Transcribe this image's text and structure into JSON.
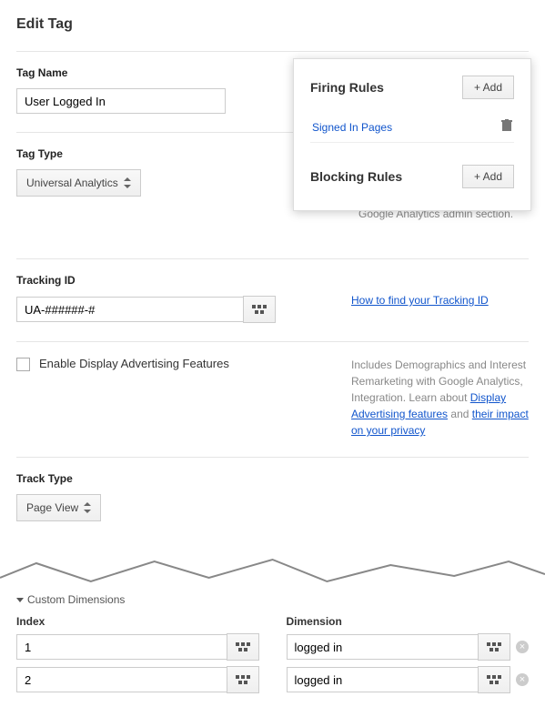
{
  "page": {
    "title": "Edit Tag"
  },
  "tag_name": {
    "label": "Tag Name",
    "value": "User Logged In"
  },
  "tag_type": {
    "label": "Tag Type",
    "selected": "Universal Analytics"
  },
  "tracking_id": {
    "label": "Tracking ID",
    "value": "UA-######-#",
    "help_link": "How to find your Tracking ID"
  },
  "display_adv": {
    "label": "Enable Display Advertising Features",
    "help_text_1": "Includes Demographics and Interest Remarketing with Google Analytics, Integration. Learn about ",
    "help_link_1": "Display Advertising features",
    "help_text_2": " and ",
    "help_link_2": "their impact on your privacy"
  },
  "track_type": {
    "label": "Track Type",
    "selected": "Page View"
  },
  "custom_dimensions": {
    "title": "Custom Dimensions",
    "index_header": "Index",
    "dimension_header": "Dimension",
    "rows": [
      {
        "index": "1",
        "dimension": "logged in"
      },
      {
        "index": "2",
        "dimension": "logged in"
      }
    ]
  },
  "rules_card": {
    "firing_label": "Firing Rules",
    "firing_add": "+ Add",
    "firing_items": [
      {
        "label": "Signed In Pages"
      }
    ],
    "blocking_label": "Blocking Rules",
    "blocking_add": "+ Add"
  },
  "obscured": {
    "text": "and can now be configured in the Google Analytics admin section."
  }
}
